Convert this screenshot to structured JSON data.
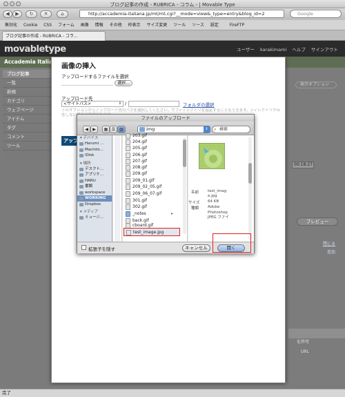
{
  "browser": {
    "window_title": "ブログ記事の作成 - RUBRICA - コラム - | Movable Type",
    "url": "http://accademia-italiana.jp/mt/mt.cgi?__mode=view&_type=entry&blog_id=2",
    "search_placeholder": "Google",
    "bookmarks": [
      "無効化",
      "Cookie",
      "CSS",
      "フォーム",
      "画像",
      "情報",
      "その他",
      "枠表示",
      "サイズ変更",
      "ツール",
      "ソース",
      "設定"
    ],
    "bookmark_extra": "FireFTP",
    "tab_title": "ブログ記事の作成 - RUBRICA - コラ..."
  },
  "mt": {
    "logo": "movabletype",
    "user_label": "ユーザー",
    "username": "karakimami",
    "help": "ヘルプ",
    "signout": "サインアウト",
    "site_name": "Accademia Italian",
    "sidebar_title": "ブログ記事",
    "sidebar_items": [
      "一覧",
      "新規",
      "カテゴリ",
      "ウェブページ",
      "アイテム",
      "タグ",
      "コメント",
      "ツール"
    ],
    "right_display_option": "表示オプション",
    "right_time": "00:18:27",
    "right_preview": "プレビュー",
    "right_close": "閉じる",
    "right_add": "追加",
    "right_allow": "を許可",
    "right_url": "URL"
  },
  "modal": {
    "title": "画像の挿入",
    "select_file_label": "アップロードするファイルを選択",
    "choose_button": "選択...",
    "upload_dest_label": "アップロード先",
    "site_path_option": "<サイトパス>",
    "path_separator": "/",
    "folder_select_link": "フォルダの選択",
    "note": "下のオプションからアップロード先のパスを選択してください。サブディレクトリを指定することもできます。ディレクトリが存在しない場合は作成されます。",
    "upload_button": "アップロード"
  },
  "dialog": {
    "title": "ファイルのアップロード",
    "current_folder": "img",
    "search_placeholder": "検索",
    "sections": {
      "devices": "デバイス",
      "places": "場所",
      "media": "メディア"
    },
    "devices": [
      "Harumi ...",
      "Macinto...",
      "iDisk"
    ],
    "places": [
      "デスクト...",
      "アプリケ...",
      "HARU",
      "書類",
      "workspace",
      "WORKING",
      "Dropbox"
    ],
    "media": [
      "ミュージ..."
    ],
    "files": [
      "203.gif",
      "204.gif",
      "205.gif",
      "206.gif",
      "207.gif",
      "208.gif",
      "209.gif",
      "209_01.gif",
      "209_02_05.gif",
      "209_06_07.gif",
      "301.gif",
      "302.gif",
      "_notes",
      "back.gif",
      "cboard.gif",
      "test_image.jpg"
    ],
    "preview": {
      "name_label": "名前",
      "name_value": "test_image.jpg",
      "size_label": "サイズ",
      "size_value": "64 KB",
      "kind_label": "種類",
      "kind_value": "Adobe Photoshop JPEG ファイ"
    },
    "hide_ext_label": "拡張子を隠す",
    "cancel": "キャンセル",
    "open": "開く"
  },
  "status": "完了",
  "highlight_color": "#e0201c"
}
